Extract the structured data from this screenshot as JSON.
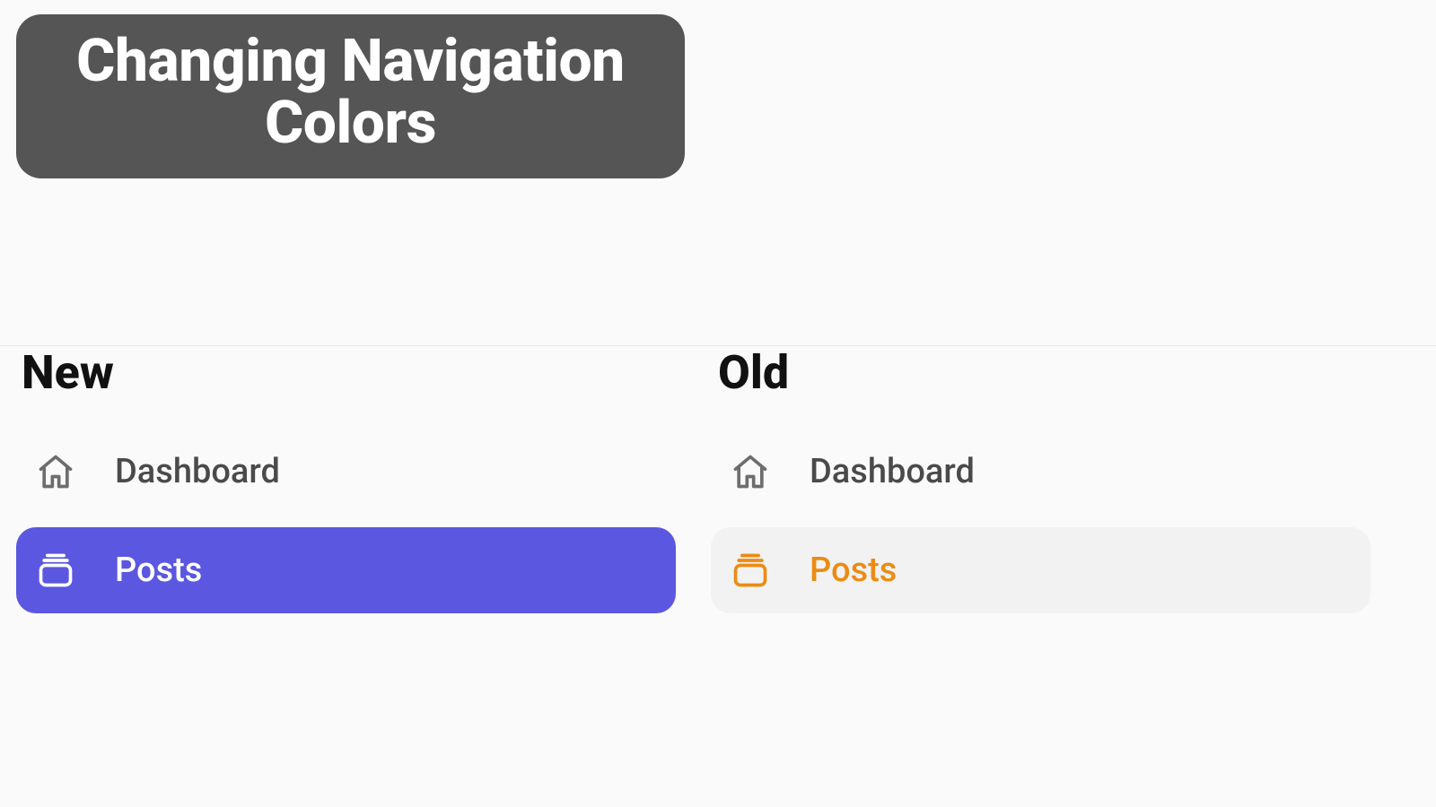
{
  "title": {
    "line1": "Changing Navigation",
    "line2": "Colors"
  },
  "sections": {
    "new_label": "New",
    "old_label": "Old"
  },
  "nav": {
    "dashboard_label": "Dashboard",
    "posts_label": "Posts"
  },
  "colors": {
    "active_new_bg": "#5b57e0",
    "active_old_accent": "#ec8b13",
    "inactive_icon": "#6d6d6d"
  }
}
